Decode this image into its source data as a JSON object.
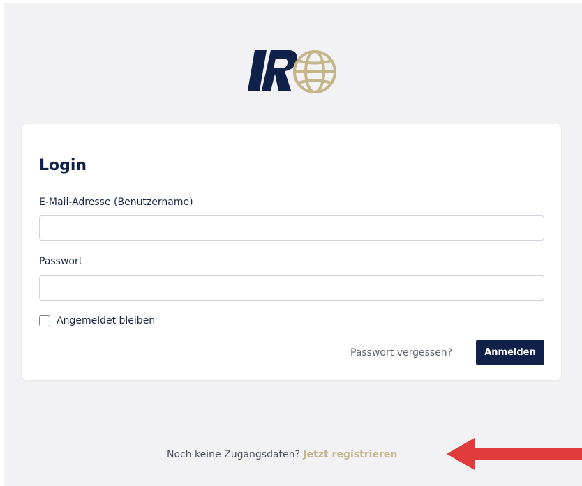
{
  "brand": {
    "logo_icon": "ir-globe-logo-icon",
    "navy": "#0f2148",
    "gold": "#c4b58a"
  },
  "login": {
    "title": "Login",
    "email_label": "E-Mail-Adresse (Benutzername)",
    "email_value": "",
    "password_label": "Passwort",
    "password_value": "",
    "remember_label": "Angemeldet bleiben",
    "remember_checked": false,
    "forgot_label": "Passwort vergessen?",
    "submit_label": "Anmelden"
  },
  "footer": {
    "prompt": "Noch keine Zugangsdaten?",
    "register_label": "Jetzt registrieren"
  },
  "annotation": {
    "arrow_icon": "left-arrow-icon",
    "arrow_color": "#e23b3b"
  }
}
